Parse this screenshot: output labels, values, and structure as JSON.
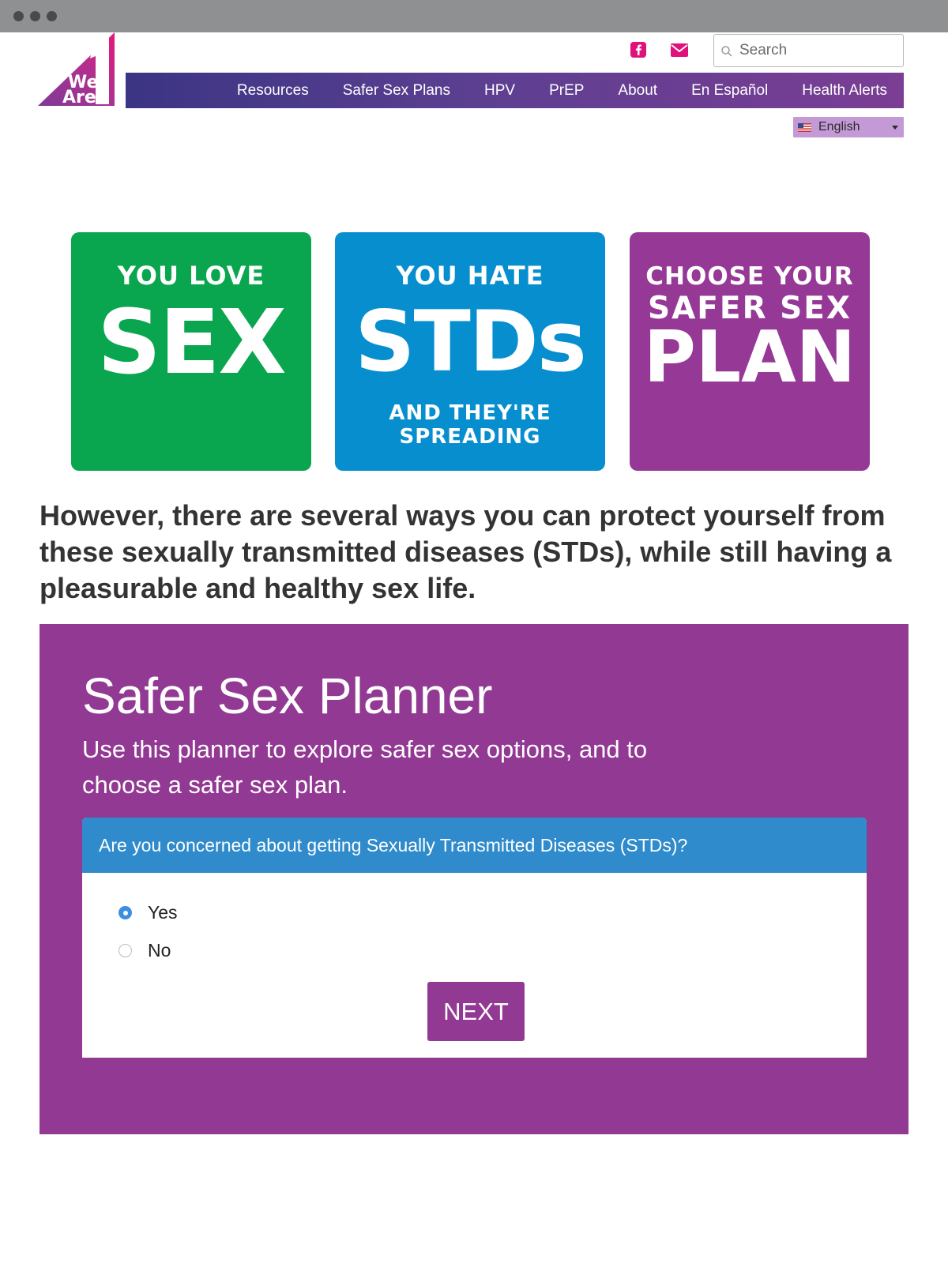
{
  "browser": {
    "controls": [
      "close",
      "minimize",
      "zoom"
    ]
  },
  "logo": {
    "text_top": "We",
    "text_bottom": "Are",
    "number": "1",
    "icon": "we-are-1-logo"
  },
  "header": {
    "social": [
      {
        "name": "facebook",
        "icon": "facebook-icon",
        "color": "#e0117a"
      },
      {
        "name": "email",
        "icon": "envelope-icon",
        "color": "#e0117a"
      }
    ],
    "search": {
      "placeholder": "Search",
      "value": ""
    }
  },
  "nav": {
    "items": [
      {
        "label": "Resources"
      },
      {
        "label": "Safer Sex Plans"
      },
      {
        "label": "HPV"
      },
      {
        "label": "PrEP"
      },
      {
        "label": "About"
      },
      {
        "label": "En Español"
      },
      {
        "label": "Health Alerts"
      }
    ]
  },
  "language": {
    "selected": "English",
    "flag_icon": "us-flag-icon"
  },
  "hero": {
    "tiles": [
      {
        "line1": "YOU LOVE",
        "big": "SEX",
        "color": "#0aa64f"
      },
      {
        "line1": "YOU HATE",
        "big": "STDs",
        "line3": "AND THEY'RE",
        "line4": "SPREADING",
        "color": "#078ecf"
      },
      {
        "line1": "CHOOSE YOUR",
        "line2": "SAFER SEX",
        "big": "PLAN",
        "color": "#953896"
      }
    ]
  },
  "headline": "However, there are several ways you can protect yourself from these sexually transmitted diseases (STDs), while still having a pleasurable and healthy sex life.",
  "planner": {
    "title": "Safer Sex Planner",
    "description": "Use this planner to explore safer sex options, and to choose a safer sex plan.",
    "question": "Are you concerned about getting Sexually Transmitted Diseases (STDs)?",
    "options": [
      {
        "label": "Yes",
        "checked": true
      },
      {
        "label": "No",
        "checked": false
      }
    ],
    "next_label": "NEXT",
    "panel_color": "#923993",
    "question_bar_color": "#2f8bcb"
  }
}
